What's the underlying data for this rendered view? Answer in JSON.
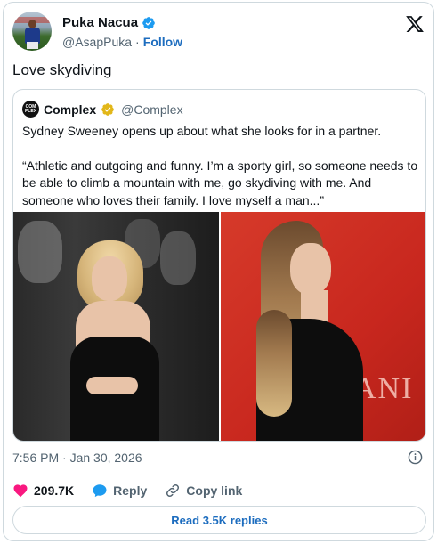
{
  "author": {
    "display_name": "Puka Nacua",
    "handle": "@AsapPuka",
    "separator": "·",
    "follow_label": "Follow"
  },
  "tweet": {
    "text": "Love skydiving"
  },
  "quote": {
    "avatar_text": "COM PLEX",
    "name": "Complex",
    "handle": "@Complex",
    "paragraph_1": "Sydney Sweeney opens up about what she looks for in a partner.",
    "paragraph_2": "“Athletic and outgoing and funny. I’m a sporty girl, so someone needs to be able to climb a mountain with me, go skydiving with me. And someone who loves their family. I love myself a man...”"
  },
  "meta": {
    "timestamp": "7:56 PM · Jan 30, 2026"
  },
  "actions": {
    "likes": "209.7K",
    "reply_label": "Reply",
    "copy_link_label": "Copy link",
    "read_replies_label": "Read 3.5K replies"
  },
  "colors": {
    "link": "#1d6dbf",
    "verified_blue": "#1d9bf0",
    "verified_gold": "#e2b719",
    "heart": "#f91880",
    "muted": "#536471",
    "border": "#cfd9de"
  },
  "icons": [
    "verified-badge-icon",
    "x-logo-icon",
    "gold-verified-badge-icon",
    "info-icon",
    "heart-icon",
    "reply-bubble-icon",
    "link-icon"
  ]
}
